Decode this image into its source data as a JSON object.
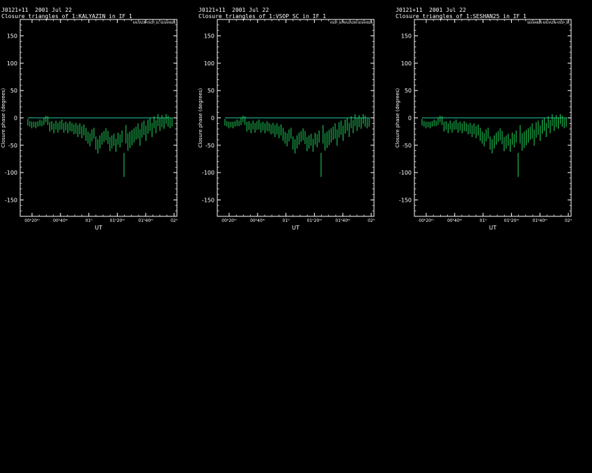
{
  "colors": {
    "background": "#000000",
    "axes": "#ffffff",
    "zero_line": "#20c0a0",
    "bars": "#20e060"
  },
  "panels": [
    {
      "header_line1": "J0121+11  2001 Jul 22",
      "header_line2": "Closure triangles of 1:KALYAZIN in IF 1",
      "triangle_label": "KALYAZIN-VSOP_SC-SESHAN25"
    },
    {
      "header_line1": "J0121+11  2001 Jul 22",
      "header_line2": "Closure triangles of 1:VSOP_SC in IF 1",
      "triangle_label": "VSOP_SC-KALYAZIN-SESHAN25"
    },
    {
      "header_line1": "J0121+11  2001 Jul 22",
      "header_line2": "Closure triangles of 1:SESHAN25 in IF 1",
      "triangle_label": "SESHAN25-KALYAZIN-VSOP_SC"
    }
  ],
  "chart_data": {
    "type": "scatter",
    "xlabel": "UT",
    "ylabel": "Closure phase  (degrees)",
    "ylim": [
      -180,
      180
    ],
    "y_ticks": [
      -150,
      -100,
      -50,
      0,
      50,
      100,
      150
    ],
    "x_ticks": [
      "00ʰ20ᵐ",
      "00ʰ40ᵐ",
      "01ʰ",
      "01ʰ20ᵐ",
      "01ʰ40ᵐ",
      "02ʰ"
    ],
    "reference_line_y": 0,
    "series": [
      {
        "style": "error bars",
        "x": [
          1,
          2,
          3,
          4,
          5,
          6,
          7,
          8,
          9,
          10,
          11,
          12,
          13,
          14,
          15,
          16,
          17,
          18,
          19,
          20,
          21,
          22,
          23,
          24,
          25,
          26,
          27,
          28,
          29,
          30,
          31,
          32,
          33,
          34,
          35,
          36,
          37,
          38,
          39,
          40,
          41,
          42,
          43,
          44,
          45,
          46,
          47,
          48,
          49,
          50,
          51,
          52,
          53,
          54,
          55,
          56,
          57,
          58,
          59,
          60,
          61,
          62,
          63,
          64,
          65,
          66,
          67,
          68,
          69,
          70,
          71,
          72,
          73
        ],
        "y": [
          -8,
          -11,
          -13,
          -12,
          -13,
          -11,
          -9,
          -10,
          -6,
          -2,
          -5,
          -16,
          -14,
          -19,
          -13,
          -18,
          -14,
          -12,
          -18,
          -15,
          -19,
          -15,
          -17,
          -21,
          -19,
          -24,
          -20,
          -26,
          -22,
          -30,
          -36,
          -40,
          -32,
          -28,
          -46,
          -52,
          -44,
          -38,
          -34,
          -30,
          -36,
          -48,
          -44,
          -40,
          -50,
          -38,
          -42,
          -34,
          -86,
          -30,
          -44,
          -40,
          -36,
          -32,
          -28,
          -24,
          -36,
          -22,
          -18,
          -28,
          -16,
          -12,
          -22,
          -8,
          -16,
          -4,
          -12,
          -6,
          -10,
          -2,
          -6,
          -10,
          -8
        ],
        "err": [
          6,
          5,
          6,
          5,
          6,
          5,
          6,
          5,
          7,
          6,
          8,
          9,
          8,
          9,
          8,
          9,
          8,
          9,
          9,
          8,
          9,
          9,
          8,
          9,
          10,
          11,
          10,
          11,
          10,
          12,
          11,
          12,
          11,
          10,
          12,
          13,
          12,
          11,
          10,
          11,
          12,
          13,
          12,
          11,
          12,
          11,
          12,
          11,
          22,
          17,
          16,
          15,
          14,
          13,
          12,
          14,
          15,
          14,
          13,
          14,
          13,
          12,
          13,
          11,
          12,
          11,
          12,
          11,
          10,
          9,
          10,
          9,
          8
        ]
      }
    ]
  }
}
